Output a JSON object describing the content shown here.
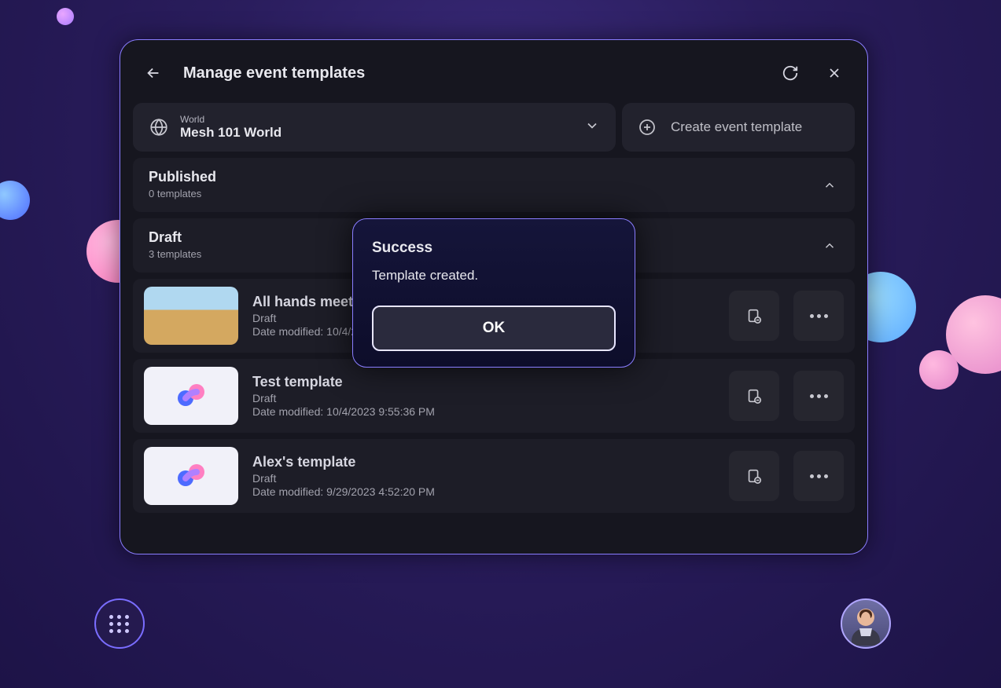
{
  "header": {
    "title": "Manage event templates"
  },
  "worldSelector": {
    "label": "World",
    "value": "Mesh 101 World"
  },
  "createButton": {
    "label": "Create event template"
  },
  "sections": {
    "published": {
      "title": "Published",
      "count": "0 templates"
    },
    "draft": {
      "title": "Draft",
      "count": "3 templates"
    }
  },
  "templates": [
    {
      "name": "All hands meeting",
      "status": "Draft",
      "date_prefix": "Date modified: 10/4/20"
    },
    {
      "name": "Test template",
      "status": "Draft",
      "date_prefix": "Date modified: 10/4/2023 9:55:36 PM"
    },
    {
      "name": "Alex's template",
      "status": "Draft",
      "date_prefix": "Date modified: 9/29/2023 4:52:20 PM"
    }
  ],
  "modal": {
    "title": "Success",
    "message": "Template created.",
    "ok": "OK"
  }
}
